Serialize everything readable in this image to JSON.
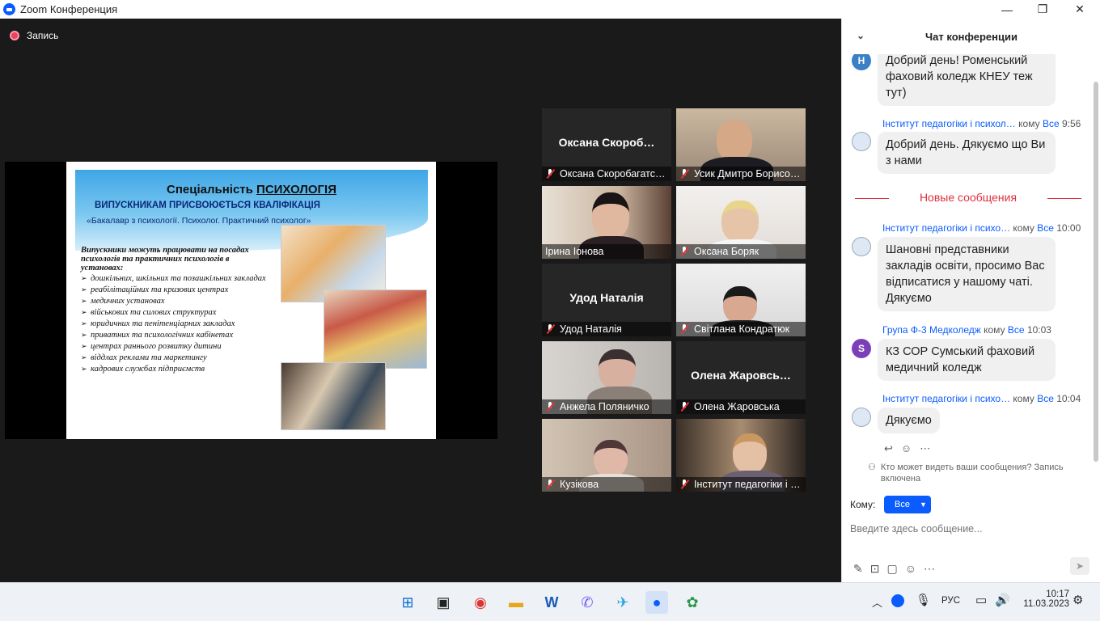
{
  "window": {
    "title": "Zoom Конференция",
    "minimize": "—",
    "maximize": "❐",
    "close": "✕"
  },
  "recording": {
    "label": "Запись"
  },
  "slide": {
    "title_prefix": "Спеціальність ",
    "title_emph": "ПСИХОЛОГІЯ",
    "line1": "ВИПУСКНИКАМ ПРИСВОЮЄТЬСЯ КВАЛІФІКАЦІЯ",
    "line2": "«Бакалавр з психології. Психолог. Практичний психолог»",
    "intro": "Випускники можуть працювати на посадах психологів та практичних психологів в установах:",
    "items": [
      "дошкільних, шкільних та позашкільних закладах",
      "реабілітаційних та кризових центрах",
      "медичних установах",
      "військових та силових структурах",
      "юридичних та пенітенціарних закладах",
      "приватних та психологічних кабінетах",
      "центрах раннього розвитку дитини",
      "віддлах реклами та маркетингу",
      "кадрових службах підприємств"
    ]
  },
  "participants": [
    {
      "big": "Оксана  Скороб…",
      "label": "Оксана Скоробагатс…"
    },
    {
      "big": "",
      "label": "Усик Дмитро Борисо…"
    },
    {
      "big": "",
      "label": "Ірина Іонова"
    },
    {
      "big": "",
      "label": "Оксана Боряк"
    },
    {
      "big": "Удод Наталія",
      "label": "Удод Наталія"
    },
    {
      "big": "",
      "label": "Світлана Кондратюк"
    },
    {
      "big": "",
      "label": "Анжела Поляничко"
    },
    {
      "big": "Олена  Жаровсь…",
      "label": "Олена Жаровська"
    },
    {
      "big": "",
      "label": "Кузікова"
    },
    {
      "big": "",
      "label": "Інститут педагогіки і …"
    }
  ],
  "chat": {
    "title": "Чат конференции",
    "msg0": {
      "avatar": "Н",
      "text": "Добрий день! Роменський фаховий коледж КНЕУ теж тут)"
    },
    "msg1": {
      "sender": "Інститут педагогіки і психол…",
      "to_word": "кому",
      "to": "Все",
      "time": "9:56",
      "text": "Добрий день. Дякуємо що Ви з нами"
    },
    "new_messages": "Новые сообщения",
    "msg2": {
      "sender": "Інститут педагогіки і психо…",
      "to_word": "кому",
      "to": "Все",
      "time": "10:00",
      "text": "Шановні представники закладів освіти, просимо Вас відписатися у нашому чаті. Дякуємо"
    },
    "msg3": {
      "avatar": "S",
      "sender": "Група Ф-3 Медколедж",
      "to_word": "кому",
      "to": "Все",
      "time": "10:03",
      "text": "КЗ СОР Сумський фаховий медичний коледж"
    },
    "msg4": {
      "sender": "Інститут педагогіки і психо…",
      "to_word": "кому",
      "to": "Все",
      "time": "10:04",
      "text": "Дякуємо"
    },
    "visibility": "Кто может видеть ваши сообщения? Запись включена",
    "to_label": "Кому:",
    "to_value": "Все",
    "placeholder": "Введите здесь сообщение..."
  },
  "taskbar": {
    "lang": "РУС",
    "time": "10:17",
    "date": "11.03.2023"
  }
}
